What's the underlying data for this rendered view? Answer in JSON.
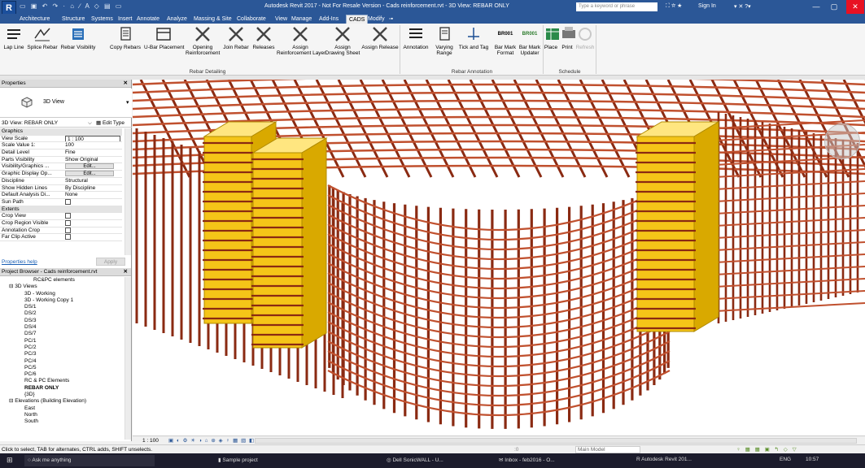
{
  "window": {
    "title": "Autodesk Revit 2017 - Not For Resale Version -   Cads reinforcement.rvt - 3D View: REBAR ONLY",
    "search_placeholder": "Type a keyword or phrase",
    "sign_in": "Sign In"
  },
  "tabs": [
    {
      "label": "Architecture"
    },
    {
      "label": "Structure"
    },
    {
      "label": "Systems"
    },
    {
      "label": "Insert"
    },
    {
      "label": "Annotate"
    },
    {
      "label": "Analyze"
    },
    {
      "label": "Massing & Site"
    },
    {
      "label": "Collaborate"
    },
    {
      "label": "View"
    },
    {
      "label": "Manage"
    },
    {
      "label": "Add-Ins"
    },
    {
      "label": "CADS"
    },
    {
      "label": "Modify"
    }
  ],
  "active_tab": "CADS",
  "ribbon": {
    "buttons": [
      {
        "label": "Lap Line",
        "icon": "lap-line-icon"
      },
      {
        "label": "Splice Rebar",
        "icon": "splice-rebar-icon"
      },
      {
        "label": "Rebar Visibility",
        "icon": "rebar-visibility-icon"
      },
      {
        "label": "Copy Rebars",
        "icon": "copy-rebars-icon"
      },
      {
        "label": "U-Bar Placement",
        "icon": "u-bar-icon"
      },
      {
        "label": "Opening\nReinforcement",
        "icon": "opening-icon"
      },
      {
        "label": "Join Rebar",
        "icon": "join-rebar-icon"
      },
      {
        "label": "Releases",
        "icon": "releases-icon"
      },
      {
        "label": "Assign\nReinforcement Layer",
        "icon": "assign-layer-icon"
      },
      {
        "label": "Assign\nDrawing Sheet",
        "icon": "assign-sheet-icon"
      },
      {
        "label": "Assign Release",
        "icon": "assign-release-icon"
      },
      {
        "label": "Annotation",
        "icon": "annotation-icon"
      },
      {
        "label": "Varying\nRange",
        "icon": "varying-range-icon"
      },
      {
        "label": "Tick and Tag",
        "icon": "tick-tag-icon"
      },
      {
        "label": "Bar Mark\nFormat",
        "icon": "bar-mark-format-icon"
      },
      {
        "label": "Bar Mark\nUpdater",
        "icon": "bar-mark-updater-icon"
      },
      {
        "label": "Place",
        "icon": "place-icon"
      },
      {
        "label": "Print",
        "icon": "print-icon"
      },
      {
        "label": "Refresh",
        "icon": "refresh-icon"
      }
    ],
    "panels": [
      "Rebar Detailing",
      "Rebar Annotation",
      "Schedule"
    ],
    "br_labels": [
      "BR001",
      "BR001"
    ]
  },
  "properties": {
    "title": "Properties",
    "type_name": "3D View",
    "filter_label": "3D View: REBAR ONLY",
    "edit_type": "Edit Type",
    "rows": [
      {
        "k": "Graphics",
        "v": "",
        "group": true
      },
      {
        "k": "View Scale",
        "v": "1 : 100"
      },
      {
        "k": "Scale Value    1:",
        "v": "100"
      },
      {
        "k": "Detail Level",
        "v": "Fine"
      },
      {
        "k": "Parts Visibility",
        "v": "Show Original"
      },
      {
        "k": "Visibility/Graphics ...",
        "v": "Edit...",
        "button": true
      },
      {
        "k": "Graphic Display Op...",
        "v": "Edit...",
        "button": true
      },
      {
        "k": "Discipline",
        "v": "Structural"
      },
      {
        "k": "Show Hidden Lines",
        "v": "By Discipline"
      },
      {
        "k": "Default Analysis Di...",
        "v": "None"
      },
      {
        "k": "Sun Path",
        "v": "",
        "check": true
      },
      {
        "k": "Extents",
        "v": "",
        "group": true
      },
      {
        "k": "Crop View",
        "v": "",
        "check": true
      },
      {
        "k": "Crop Region Visible",
        "v": "",
        "check": true
      },
      {
        "k": "Annotation Crop",
        "v": "",
        "check": true
      },
      {
        "k": "Far Clip Active",
        "v": "",
        "check": true
      }
    ],
    "help": "Properties help",
    "apply": "Apply"
  },
  "browser": {
    "title": "Project Browser - Cads reinforcement.rvt",
    "items": [
      {
        "label": "RC&PC elements",
        "indent": 3
      },
      {
        "label": "3D Views",
        "indent": 1,
        "expander": "⊟"
      },
      {
        "label": "3D - Working",
        "indent": 2
      },
      {
        "label": "3D - Working Copy 1",
        "indent": 2
      },
      {
        "label": "DS/1",
        "indent": 2
      },
      {
        "label": "DS/2",
        "indent": 2
      },
      {
        "label": "DS/3",
        "indent": 2
      },
      {
        "label": "DS/4",
        "indent": 2
      },
      {
        "label": "DS/7",
        "indent": 2
      },
      {
        "label": "PC/1",
        "indent": 2
      },
      {
        "label": "PC/2",
        "indent": 2
      },
      {
        "label": "PC/3",
        "indent": 2
      },
      {
        "label": "PC/4",
        "indent": 2
      },
      {
        "label": "PC/5",
        "indent": 2
      },
      {
        "label": "PC/6",
        "indent": 2
      },
      {
        "label": "RC & PC Elements",
        "indent": 2
      },
      {
        "label": "REBAR ONLY",
        "indent": 2,
        "bold": true
      },
      {
        "label": "{3D}",
        "indent": 2
      },
      {
        "label": "Elevations (Building Elevation)",
        "indent": 1,
        "expander": "⊟"
      },
      {
        "label": "East",
        "indent": 2
      },
      {
        "label": "North",
        "indent": 2
      },
      {
        "label": "South",
        "indent": 2
      }
    ]
  },
  "viewbar": {
    "scale": "1 : 100"
  },
  "status": {
    "text": "Click to select, TAB for alternates, CTRL adds, SHIFT unselects.",
    "count": ":0",
    "model": "Main Model"
  },
  "taskbar": {
    "search": "Ask me anything",
    "items": [
      "Sample project",
      "Dell SonicWALL - U...",
      "Inbox - feb2016 - O...",
      "Autodesk Revit 201..."
    ],
    "lang": "ENG",
    "time": "10:57"
  }
}
